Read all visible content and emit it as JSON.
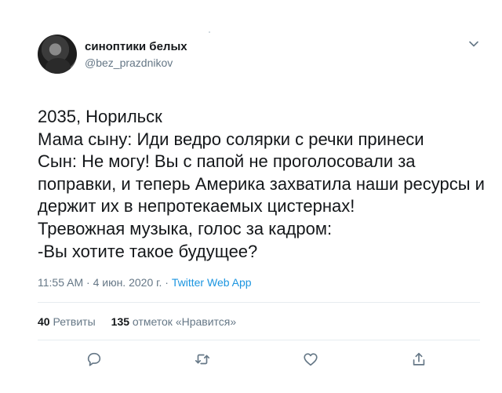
{
  "user": {
    "display_name": "синоптики белых",
    "handle": "@bez_prazdnikov"
  },
  "tweet": {
    "text": "2035, Норильск\nМама сыну: Иди ведро солярки с речки принеси\nСын: Не могу! Вы с папой не проголосовали за поправки, и теперь Америка захватила наши ресурсы и держит их в непротекаемых цистернах!\nТревожная музыка, голос за кадром:\n-Вы хотите такое будущее?"
  },
  "meta": {
    "time": "11:55 AM",
    "separator1": " · ",
    "date": "4 июн. 2020 г.",
    "separator2": " · ",
    "app": "Twitter Web App"
  },
  "stats": {
    "retweets_count": "40",
    "retweets_label": "Ретвиты",
    "likes_count": "135",
    "likes_label": "отметок «Нравится»"
  },
  "colors": {
    "link": "#1b95e0",
    "muted": "#657786",
    "text": "#14171a",
    "divider": "#e6ecf0"
  },
  "icons": [
    "chevron-down-icon",
    "reply-icon",
    "retweet-icon",
    "like-icon",
    "share-icon"
  ]
}
